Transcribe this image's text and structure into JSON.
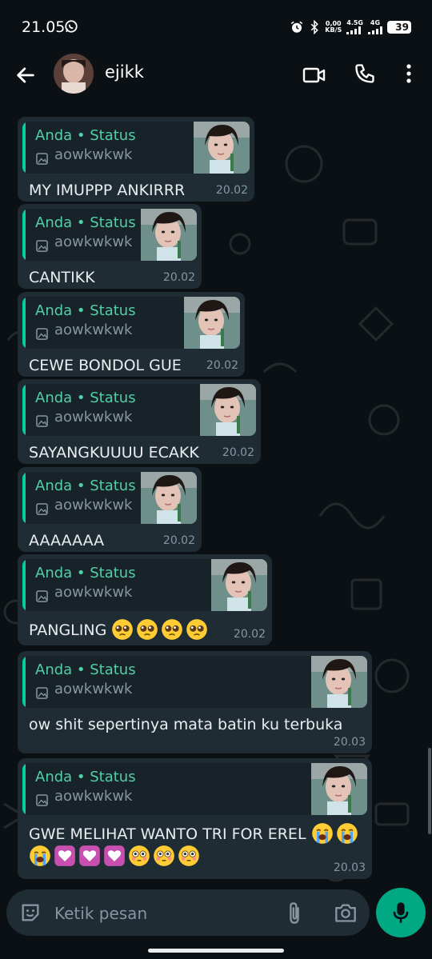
{
  "status_bar": {
    "time": "21.05",
    "net_speed_value": "0,00",
    "net_speed_unit": "KB/S",
    "signal1": "4.5G",
    "signal2": "4G",
    "battery": "39"
  },
  "header": {
    "contact_name": "ejikk",
    "back_icon": "arrow-left-icon",
    "video_icon": "video-camera-icon",
    "call_icon": "phone-icon",
    "menu_icon": "more-vertical-icon"
  },
  "messages": [
    {
      "quote_author": "Anda • Status",
      "quote_caption": "aowkwkwk",
      "text": "MY IMUPPP ANKIRRR",
      "time": "20.02"
    },
    {
      "quote_author": "Anda • Status",
      "quote_caption": "aowkwkwk",
      "text": "CANTIKK",
      "time": "20.02"
    },
    {
      "quote_author": "Anda • Status",
      "quote_caption": "aowkwkwk",
      "text": "CEWE BONDOL GUE",
      "time": "20.02"
    },
    {
      "quote_author": "Anda • Status",
      "quote_caption": "aowkwkwk",
      "text": "SAYANGKUUUU ECAKK",
      "time": "20.02"
    },
    {
      "quote_author": "Anda • Status",
      "quote_caption": "aowkwkwk",
      "text": "AAAAAAA",
      "time": "20.02"
    },
    {
      "quote_author": "Anda • Status",
      "quote_caption": "aowkwkwk",
      "text": "PANGLING",
      "time": "20.02",
      "emojis": [
        "pleading-face",
        "pleading-face",
        "pleading-face",
        "pleading-face"
      ]
    },
    {
      "quote_author": "Anda • Status",
      "quote_caption": "aowkwkwk",
      "text": "ow shit sepertinya mata batin ku terbuka",
      "time": "20.03"
    },
    {
      "quote_author": "Anda • Status",
      "quote_caption": "aowkwkwk",
      "text": "GWE MELIHAT WANTO TRI FOR EREL",
      "time": "20.03",
      "emojis": [
        "loudly-crying-face",
        "loudly-crying-face",
        "loudly-crying-face",
        "heart-decoration",
        "heart-decoration",
        "heart-decoration",
        "flushed-face",
        "flushed-face",
        "flushed-face"
      ]
    }
  ],
  "input": {
    "placeholder": "Ketik pesan",
    "emoji_icon": "sticker-smile-icon",
    "attach_icon": "paperclip-icon",
    "camera_icon": "camera-icon",
    "mic_icon": "microphone-icon"
  },
  "colors": {
    "background": "#0b1014",
    "bubble": "#1f2c34",
    "quote": "#182229",
    "quote_bar": "#06cf9c",
    "quote_author": "#50d0a8",
    "accent": "#00a884"
  }
}
